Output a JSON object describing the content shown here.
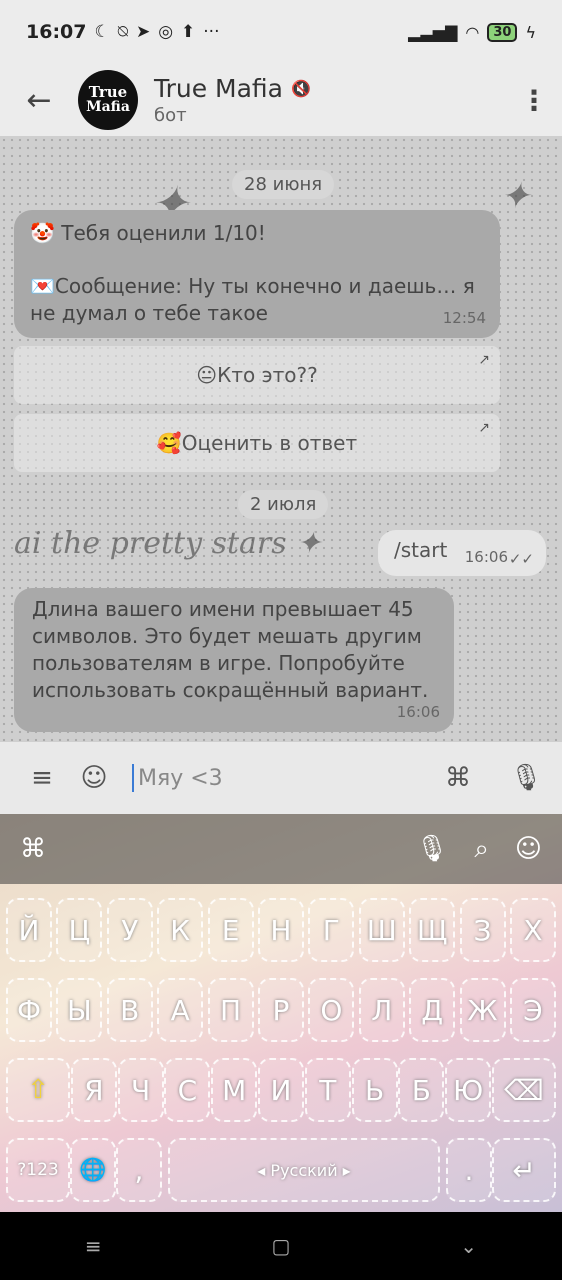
{
  "status_bar": {
    "time": "16:07",
    "battery": "30"
  },
  "header": {
    "back_icon": "arrow-left",
    "avatar_text": "True Mafia",
    "title": "True Mafia",
    "subtitle": "бот",
    "menu_icon": "kebab-menu"
  },
  "chat": {
    "date1": "28 июня",
    "msg1_line1": "🤡 Тебя оценили 1/10!",
    "msg1_line2": "💌Сообщение: Ну ты конечно и даешь… я не думал о тебе такое",
    "msg1_time": "12:54",
    "btn1_label": "😐Кто это??",
    "btn2_label": "🥰Оценить в ответ",
    "date2": "2 июля",
    "out_msg": "/start",
    "out_time": "16:06",
    "msg2_text": "Длина вашего имени превышает 45 символов. Это будет мешать другим пользователям в игре. Попробуйте использовать сокращённый вариант.",
    "msg2_time": "16:06"
  },
  "input": {
    "placeholder": "Мяу <3"
  },
  "keyboard": {
    "row1": [
      "Й",
      "Ц",
      "У",
      "К",
      "Е",
      "Н",
      "Г",
      "Ш",
      "Щ",
      "З",
      "Х"
    ],
    "row2": [
      "Ф",
      "Ы",
      "В",
      "А",
      "П",
      "Р",
      "О",
      "Л",
      "Д",
      "Ж",
      "Э"
    ],
    "row3": [
      "Я",
      "Ч",
      "С",
      "М",
      "И",
      "Т",
      "Ь",
      "Б",
      "Ю"
    ],
    "symbols_label": "?123",
    "comma": ",",
    "space_label": "◂ Русский ▸",
    "dot": "."
  }
}
